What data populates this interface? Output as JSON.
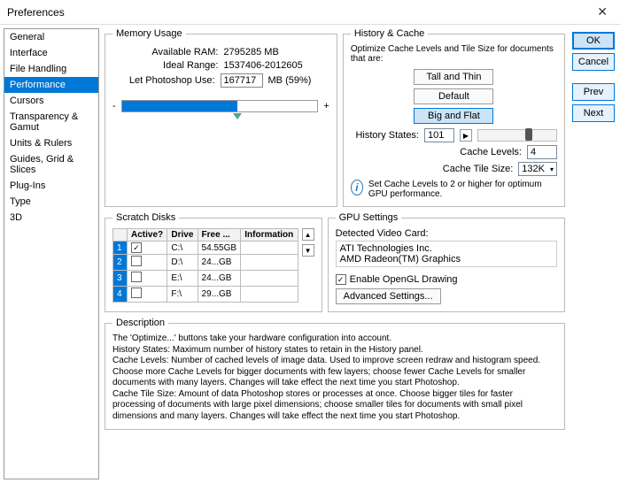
{
  "window": {
    "title": "Preferences"
  },
  "sidebar": {
    "items": [
      {
        "label": "General"
      },
      {
        "label": "Interface"
      },
      {
        "label": "File Handling"
      },
      {
        "label": "Performance"
      },
      {
        "label": "Cursors"
      },
      {
        "label": "Transparency & Gamut"
      },
      {
        "label": "Units & Rulers"
      },
      {
        "label": "Guides, Grid & Slices"
      },
      {
        "label": "Plug-Ins"
      },
      {
        "label": "Type"
      },
      {
        "label": "3D"
      }
    ],
    "selected_index": 3
  },
  "buttons": {
    "ok": "OK",
    "cancel": "Cancel",
    "prev": "Prev",
    "next": "Next"
  },
  "memory": {
    "legend": "Memory Usage",
    "available_label": "Available RAM:",
    "available_value": "2795285 MB",
    "ideal_label": "Ideal Range:",
    "ideal_value": "1537406-2012605",
    "use_label": "Let Photoshop Use:",
    "use_value": "167717",
    "use_suffix": "MB (59%)",
    "minus": "-",
    "plus": "+"
  },
  "history_cache": {
    "legend": "History & Cache",
    "intro": "Optimize Cache Levels and Tile Size for documents that are:",
    "tall": "Tall and Thin",
    "default": "Default",
    "big": "Big and Flat",
    "hist_label": "History States:",
    "hist_value": "101",
    "cache_label": "Cache Levels:",
    "cache_value": "4",
    "tile_label": "Cache Tile Size:",
    "tile_value": "132K",
    "tip": "Set Cache Levels to 2 or higher for optimum GPU performance."
  },
  "scratch": {
    "legend": "Scratch Disks",
    "cols": {
      "active": "Active?",
      "drive": "Drive",
      "free": "Free ...",
      "info": "Information"
    },
    "rows": [
      {
        "n": "1",
        "active": true,
        "drive": "C:\\",
        "free": "54.55GB",
        "info": ""
      },
      {
        "n": "2",
        "active": false,
        "drive": "D:\\",
        "free": "24...GB",
        "info": ""
      },
      {
        "n": "3",
        "active": false,
        "drive": "E:\\",
        "free": "24...GB",
        "info": ""
      },
      {
        "n": "4",
        "active": false,
        "drive": "F:\\",
        "free": "29...GB",
        "info": ""
      }
    ]
  },
  "gpu": {
    "legend": "GPU Settings",
    "detected_label": "Detected Video Card:",
    "line1": "ATI Technologies Inc.",
    "line2": "AMD Radeon(TM) Graphics",
    "enable": "Enable OpenGL Drawing",
    "enable_checked": true,
    "advanced": "Advanced Settings..."
  },
  "description": {
    "legend": "Description",
    "p1": "The 'Optimize...' buttons take your hardware configuration into account.",
    "p2": "History States: Maximum number of history states to retain in the History panel.",
    "p3": "Cache Levels: Number of cached levels of image data.  Used to improve screen redraw and histogram speed.  Choose more Cache Levels for bigger documents with few layers; choose fewer Cache Levels for smaller documents with many layers. Changes will take effect the next time you start Photoshop.",
    "p4": "Cache Tile Size: Amount of data Photoshop stores or processes at once. Choose bigger tiles for faster processing of documents with large pixel dimensions; choose smaller tiles for documents with small pixel dimensions and many layers. Changes will take effect the next time you start Photoshop."
  }
}
